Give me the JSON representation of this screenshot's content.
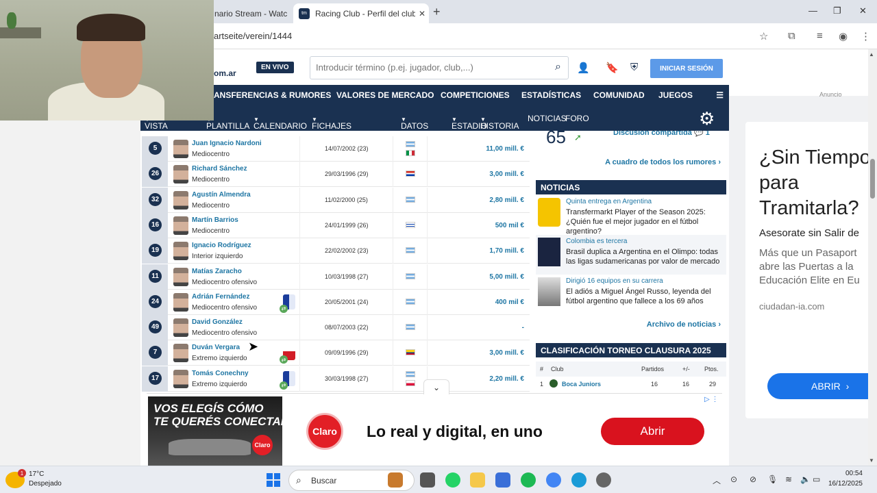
{
  "browser": {
    "tabs": [
      {
        "label": "nario Stream - Watc",
        "active": false
      },
      {
        "label": "Racing Club - Perfil del club | Tr",
        "favicon": "tm",
        "active": true
      }
    ],
    "url": "artseite/verein/1444"
  },
  "site": {
    "logo_suffix": "om.ar",
    "live_badge": "EN VIVO",
    "search_placeholder": "Introducir término (p.ej. jugador, club,...)",
    "login_label": "INICIAR SESIÓN",
    "main_nav": [
      "ANSFERENCIAS & RUMORES",
      "VALORES DE MERCADO",
      "COMPETICIONES",
      "ESTADÍSTICAS",
      "COMUNIDAD",
      "JUEGOS"
    ],
    "sub_nav": [
      "VISTA GENERAL",
      "PLANTILLA",
      "CALENDARIO",
      "FICHAJES Y RUMORES",
      "DATOS",
      "ESTADIO",
      "HISTORIA",
      "NOTICIAS",
      "FORO"
    ],
    "dropdown_caret": "▼"
  },
  "squad": [
    {
      "number": "5",
      "name": "Juan Ignacio Nardoni",
      "position": "Mediocentro",
      "dob": "14/07/2002 (23)",
      "flags": [
        "argentina",
        "italy"
      ],
      "value": "11,00 mill. €"
    },
    {
      "number": "26",
      "name": "Richard Sánchez",
      "position": "Mediocentro",
      "dob": "29/03/1996 (29)",
      "flags": [
        "paraguay"
      ],
      "value": "3,00 mill. €"
    },
    {
      "number": "32",
      "name": "Agustín Almendra",
      "position": "Mediocentro",
      "dob": "11/02/2000 (25)",
      "flags": [
        "argentina"
      ],
      "value": "2,80 mill. €"
    },
    {
      "number": "16",
      "name": "Martín Barrios",
      "position": "Mediocentro",
      "dob": "24/01/1999 (26)",
      "flags": [
        "uruguay"
      ],
      "value": "500 mil €"
    },
    {
      "number": "19",
      "name": "Ignacio Rodríguez",
      "position": "Interior izquierdo",
      "dob": "22/02/2002 (23)",
      "flags": [
        "argentina"
      ],
      "value": "1,70 mill. €"
    },
    {
      "number": "11",
      "name": "Matías Zaracho",
      "position": "Mediocentro ofensivo",
      "dob": "10/03/1998 (27)",
      "flags": [
        "argentina"
      ],
      "value": "5,00 mill. €"
    },
    {
      "number": "24",
      "name": "Adrián Fernández",
      "position": "Mediocentro ofensivo",
      "dob": "20/05/2001 (24)",
      "flags": [
        "argentina"
      ],
      "value": "400 mil €",
      "loan_badge": "blue"
    },
    {
      "number": "49",
      "name": "David González",
      "position": "Mediocentro ofensivo",
      "dob": "08/07/2003 (22)",
      "flags": [
        "argentina"
      ],
      "value": "-"
    },
    {
      "number": "7",
      "name": "Duván Vergara",
      "position": "Extremo izquierdo",
      "dob": "09/09/1996 (29)",
      "flags": [
        "colombia"
      ],
      "value": "3,00 mill. €",
      "loan_badge": "red"
    },
    {
      "number": "17",
      "name": "Tomás Conechny",
      "position": "Extremo izquierdo",
      "dob": "30/03/1998 (27)",
      "flags": [
        "argentina",
        "poland"
      ],
      "value": "2,20 mill. €",
      "loan_badge": "blue"
    }
  ],
  "rumors": {
    "count": "65",
    "discussion": "Discusión compartida",
    "comments": "1",
    "link": "A cuadro de todos los rumores"
  },
  "news": {
    "header": "NOTICIAS",
    "items": [
      {
        "category": "Quinta entrega en Argentina",
        "title": "Transfermarkt Player of the Season 2025: ¿Quién fue el mejor jugador en el fútbol argentino?",
        "image": "lpf-logo"
      },
      {
        "category": "Colombia es tercera",
        "title": "Brasil duplica a Argentina en el Olimpo: todas las ligas sudamericanas por valor de mercado",
        "image": "leagues-graphic"
      },
      {
        "category": "Dirigió 16 equipos en su carrera",
        "title": "El adiós a Miguel Ángel Russo, leyenda del fútbol argentino que fallece a los 69 años",
        "image": "portrait"
      }
    ],
    "archive_link": "Archivo de noticias"
  },
  "standings": {
    "header": "CLASIFICACIÓN TORNEO CLAUSURA 2025",
    "columns": [
      "#",
      "Club",
      "Partidos",
      "+/-",
      "Ptos."
    ],
    "rows": [
      {
        "pos": "1",
        "club": "Boca Juniors",
        "played": "16",
        "diff": "16",
        "points": "29"
      }
    ]
  },
  "right_ad": {
    "anuncio": "Anuncio",
    "headline_lines": [
      "¿Sin Tiempo",
      "para",
      "Tramitarla?"
    ],
    "subhead": "Asesorate sin Salir de",
    "body_lines": [
      "Más que un Pasaport",
      "abre las Puertas a la",
      "Educación Elite en Eu"
    ],
    "domain": "ciudadan-ia.com",
    "button": "ABRIR"
  },
  "bottom_ad": {
    "image_text": [
      "VOS ELEGÍS CÓMO",
      "TE QUERÉS CONECTAR"
    ],
    "brand": "Claro",
    "headline": "Lo real y digital, en uno",
    "button": "Abrir"
  },
  "taskbar": {
    "temperature": "17°C",
    "weather": "Despejado",
    "weather_badge": "1",
    "search": "Buscar",
    "time": "00:54",
    "date": "16/12/2025"
  },
  "colors": {
    "navy": "#1a3151",
    "link": "#1d75a3",
    "login": "#5c9ae8",
    "claro_red": "#d9121e",
    "ad_blue": "#1a73e8"
  }
}
